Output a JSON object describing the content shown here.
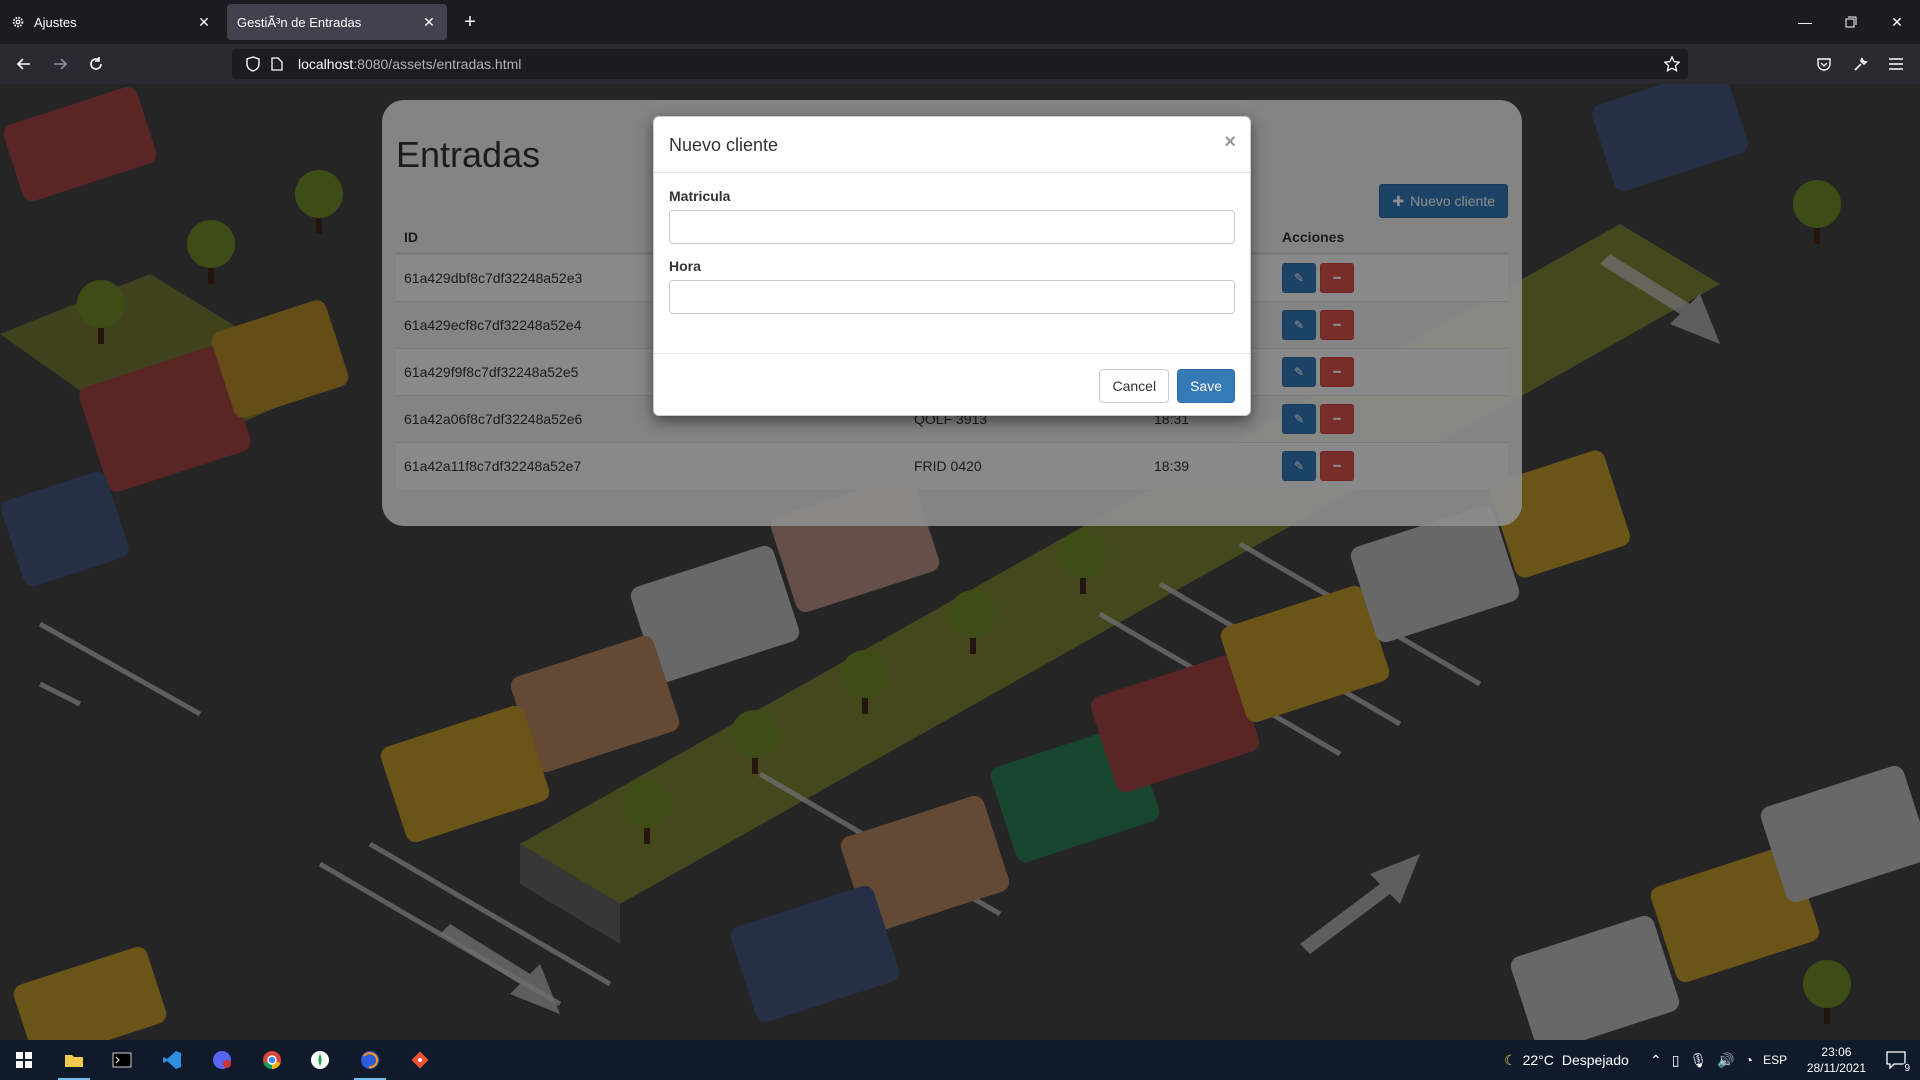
{
  "browser": {
    "tabs": [
      {
        "title": "Ajustes",
        "icon": "gear-icon",
        "active": false
      },
      {
        "title": "GestiÃ³n de Entradas",
        "icon": "",
        "active": true
      }
    ],
    "url_host": "localhost",
    "url_rest": ":8080/assets/entradas.html"
  },
  "page": {
    "title": "Entradas",
    "new_button_label": "Nuevo cliente",
    "columns": [
      "ID",
      "",
      "",
      "Acciones"
    ],
    "rows": [
      {
        "id": "61a429dbf8c7df32248a52e3",
        "matricula": "",
        "hora": ""
      },
      {
        "id": "61a429ecf8c7df32248a52e4",
        "matricula": "",
        "hora": ""
      },
      {
        "id": "61a429f9f8c7df32248a52e5",
        "matricula": "",
        "hora": ""
      },
      {
        "id": "61a42a06f8c7df32248a52e6",
        "matricula": "QOLF 3913",
        "hora": "18:31"
      },
      {
        "id": "61a42a11f8c7df32248a52e7",
        "matricula": "FRID 0420",
        "hora": "18:39"
      }
    ]
  },
  "modal": {
    "title": "Nuevo cliente",
    "close": "×",
    "fields": [
      {
        "label": "Matricula",
        "value": ""
      },
      {
        "label": "Hora",
        "value": ""
      }
    ],
    "cancel_label": "Cancel",
    "save_label": "Save"
  },
  "taskbar": {
    "weather_temp": "22°C",
    "weather_text": "Despejado",
    "lang": "ESP",
    "time": "23:06",
    "date": "28/11/2021",
    "notif_count": "9"
  },
  "colors": {
    "primary": "#337ab7",
    "danger": "#d9534f",
    "taskbar": "#0f1a2b"
  }
}
